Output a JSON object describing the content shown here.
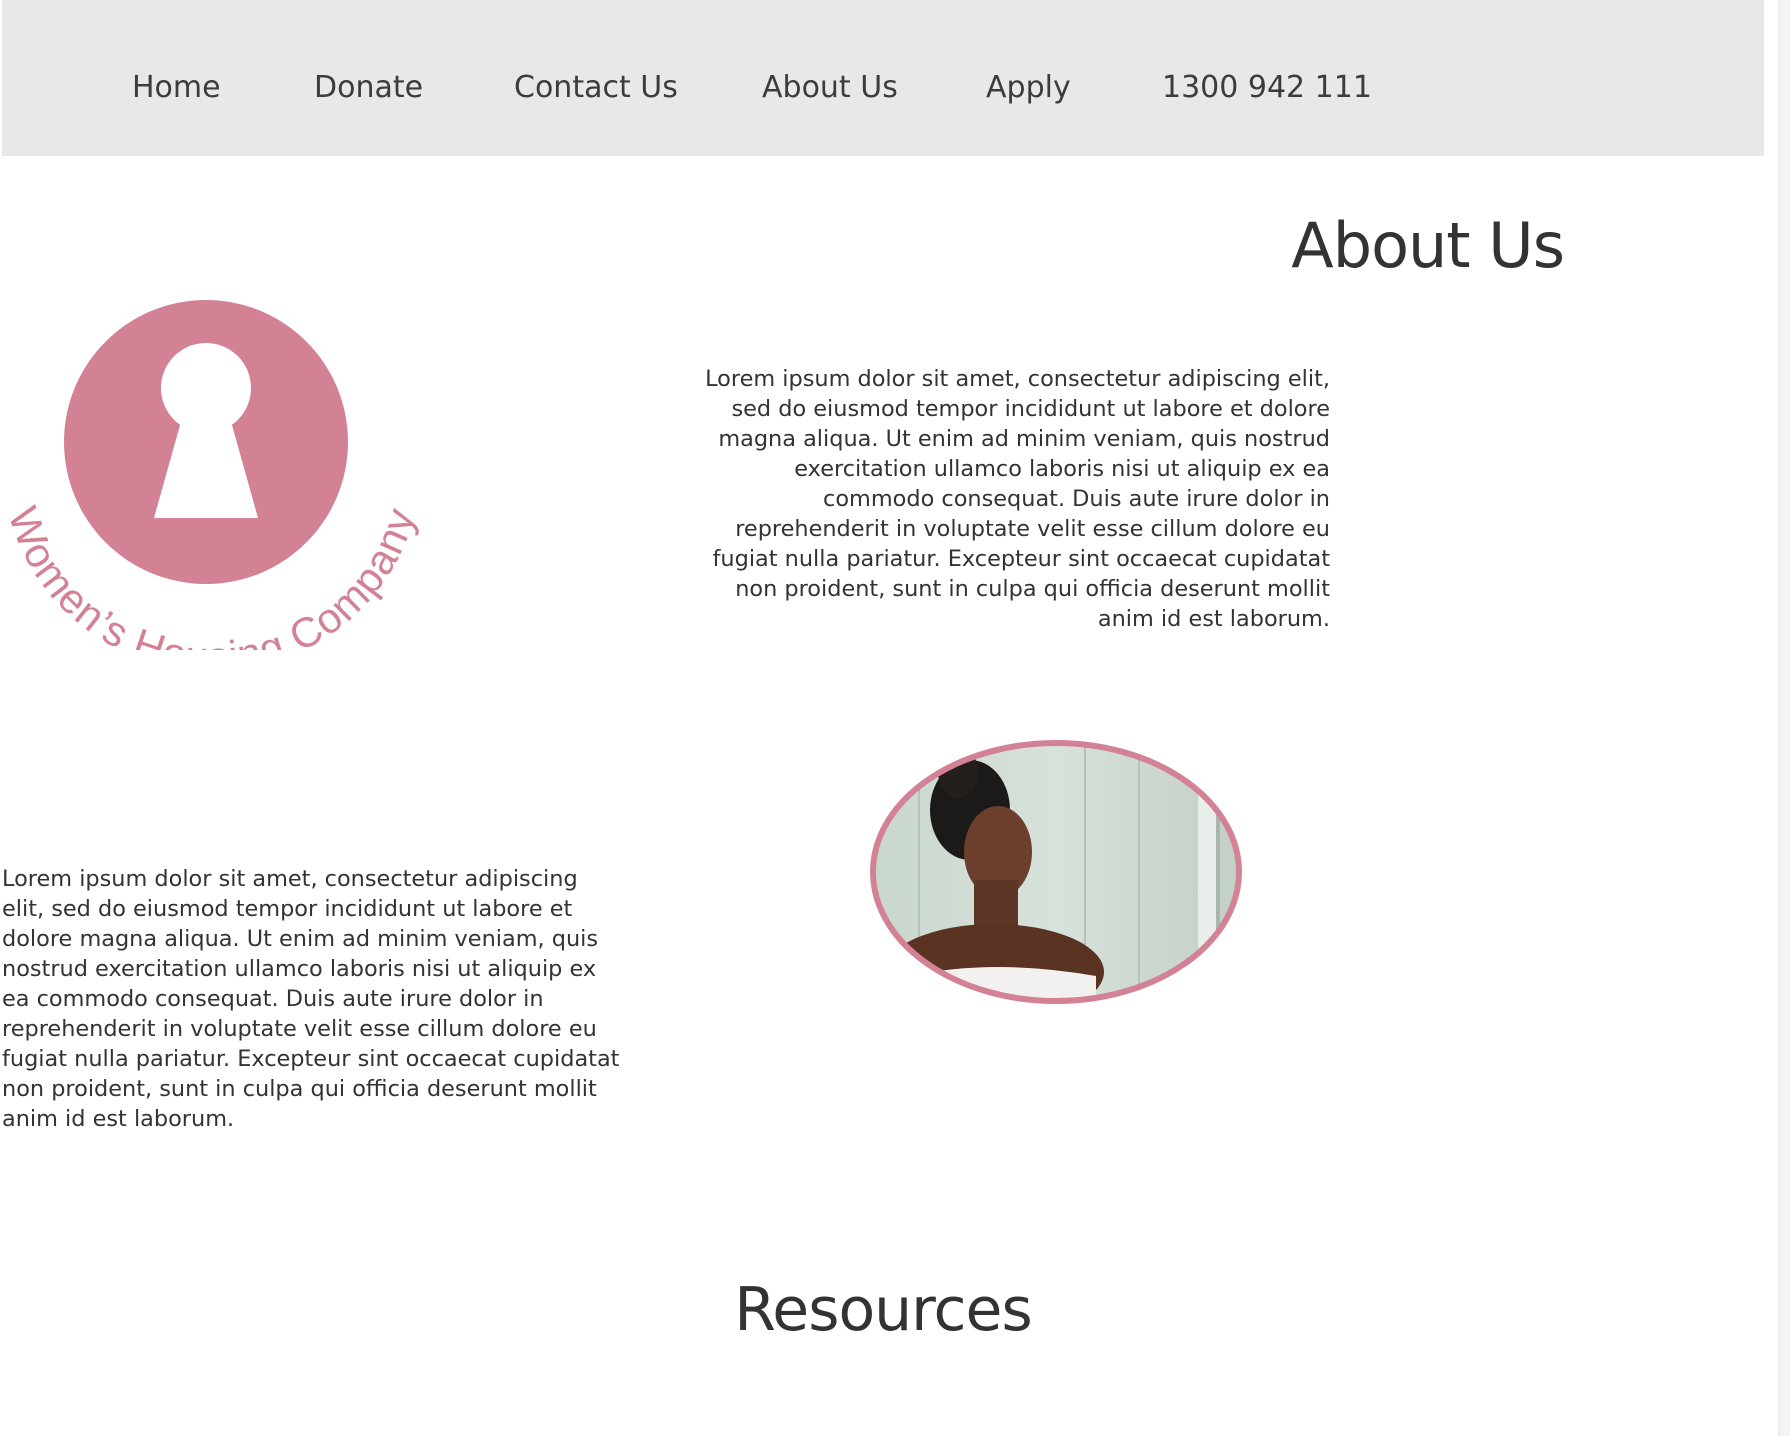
{
  "nav": {
    "items": [
      {
        "label": "Home",
        "name": "nav-home"
      },
      {
        "label": "Donate",
        "name": "nav-donate"
      },
      {
        "label": "Contact Us",
        "name": "nav-contact-us"
      },
      {
        "label": "About Us",
        "name": "nav-about-us"
      },
      {
        "label": "Apply",
        "name": "nav-apply"
      },
      {
        "label": "1300 942 111",
        "name": "nav-phone"
      }
    ]
  },
  "about": {
    "title": "About Us",
    "paragraph_right": "Lorem ipsum dolor sit amet, consectetur adipiscing elit, sed do eiusmod tempor incididunt ut labore et dolore magna aliqua. Ut enim ad minim veniam, quis nostrud exercitation ullamco laboris nisi ut aliquip ex ea commodo consequat. Duis aute irure dolor in reprehenderit in voluptate velit esse cillum dolore eu fugiat nulla pariatur. Excepteur sint occaecat cupidatat non proident, sunt in culpa qui officia deserunt mollit anim id est laborum.",
    "paragraph_left": "Lorem ipsum dolor sit amet, consectetur adipiscing elit, sed do eiusmod tempor incididunt ut labore et dolore magna aliqua. Ut enim ad minim veniam, quis nostrud exercitation ullamco laboris nisi ut aliquip ex ea commodo consequat. Duis aute irure dolor in reprehenderit in voluptate velit esse cillum dolore eu fugiat nulla pariatur. Excepteur sint occaecat cupidatat non proident, sunt in culpa qui officia deserunt mollit anim id est laborum."
  },
  "logo": {
    "text": "Women’s Housing Company",
    "color": "#d38295"
  },
  "resources": {
    "title": "Resources"
  },
  "colors": {
    "nav_background": "#e8e8e8",
    "accent_pink": "#d38295",
    "text": "#333333"
  }
}
